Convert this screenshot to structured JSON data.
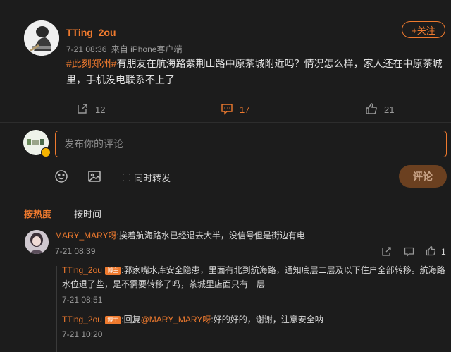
{
  "post": {
    "username": "TTing_2ou",
    "timestamp": "7-21 08:36",
    "source": "来自 iPhone客户端",
    "follow_label": "+关注",
    "hashtag": "#此刻郑州#",
    "text": "有朋友在航海路紫荆山路中原茶城附近吗？情况怎么样，家人还在中原茶城里，手机没电联系不上了",
    "repost_count": "12",
    "comment_count": "17",
    "like_count": "21"
  },
  "composer": {
    "placeholder": "发布你的评论",
    "repost_label": "同时转发",
    "submit_label": "评论"
  },
  "sort_tabs": [
    {
      "label": "按热度",
      "active": true
    },
    {
      "label": "按时间",
      "active": false
    }
  ],
  "comments": [
    {
      "username": "MARY_MARY呀",
      "text": ":挨着航海路水已经退去大半，没信号但是街边有电",
      "time": "7-21 08:39",
      "like_count": "1",
      "replies": [
        {
          "username": "TTing_2ou",
          "badge": "博主",
          "text": ":郛家嘴水库安全隐患，里面有北到航海路，通知底层二层及以下住户全部转移。航海路水位退了些，是不需要转移了吗，茶城里店面只有一层",
          "time": "7-21 08:51"
        },
        {
          "username": "TTing_2ou",
          "badge": "博主",
          "reply_prefix": ":回复",
          "mention": "@MARY_MARY呀",
          "text": ":好的好的，谢谢，注意安全呐",
          "time": "7-21 10:20"
        }
      ]
    }
  ],
  "colors": {
    "accent": "#ef7a2e",
    "background": "#1c1c1c",
    "muted_text": "#9a9a9a"
  },
  "icons": [
    "repost-icon",
    "comment-icon",
    "like-icon",
    "emoji-icon",
    "image-icon",
    "checkbox-icon"
  ]
}
